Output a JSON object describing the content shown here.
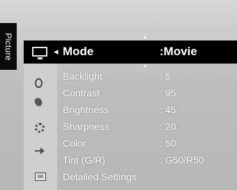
{
  "side_tab": {
    "label": "Picture"
  },
  "selected": {
    "label": "Mode",
    "value": ":Movie"
  },
  "items": [
    {
      "label": "Backlight",
      "value": ": 5"
    },
    {
      "label": "Contrast",
      "value": ": 95"
    },
    {
      "label": "Brightness",
      "value": ": 45"
    },
    {
      "label": "Sharpness",
      "value": ": 20"
    },
    {
      "label": "Color",
      "value": ": 50"
    },
    {
      "label": "Tint (G/R)",
      "value": ": G50/R50"
    },
    {
      "label": "Detailed Settings",
      "value": ""
    }
  ],
  "icons": [
    "picture-icon",
    "sound-icon",
    "channel-icon",
    "setup-icon",
    "input-icon",
    "application-icon"
  ],
  "colors": {
    "highlight": "#000000",
    "background": "#c6c6c6",
    "text": "#ffffff"
  }
}
